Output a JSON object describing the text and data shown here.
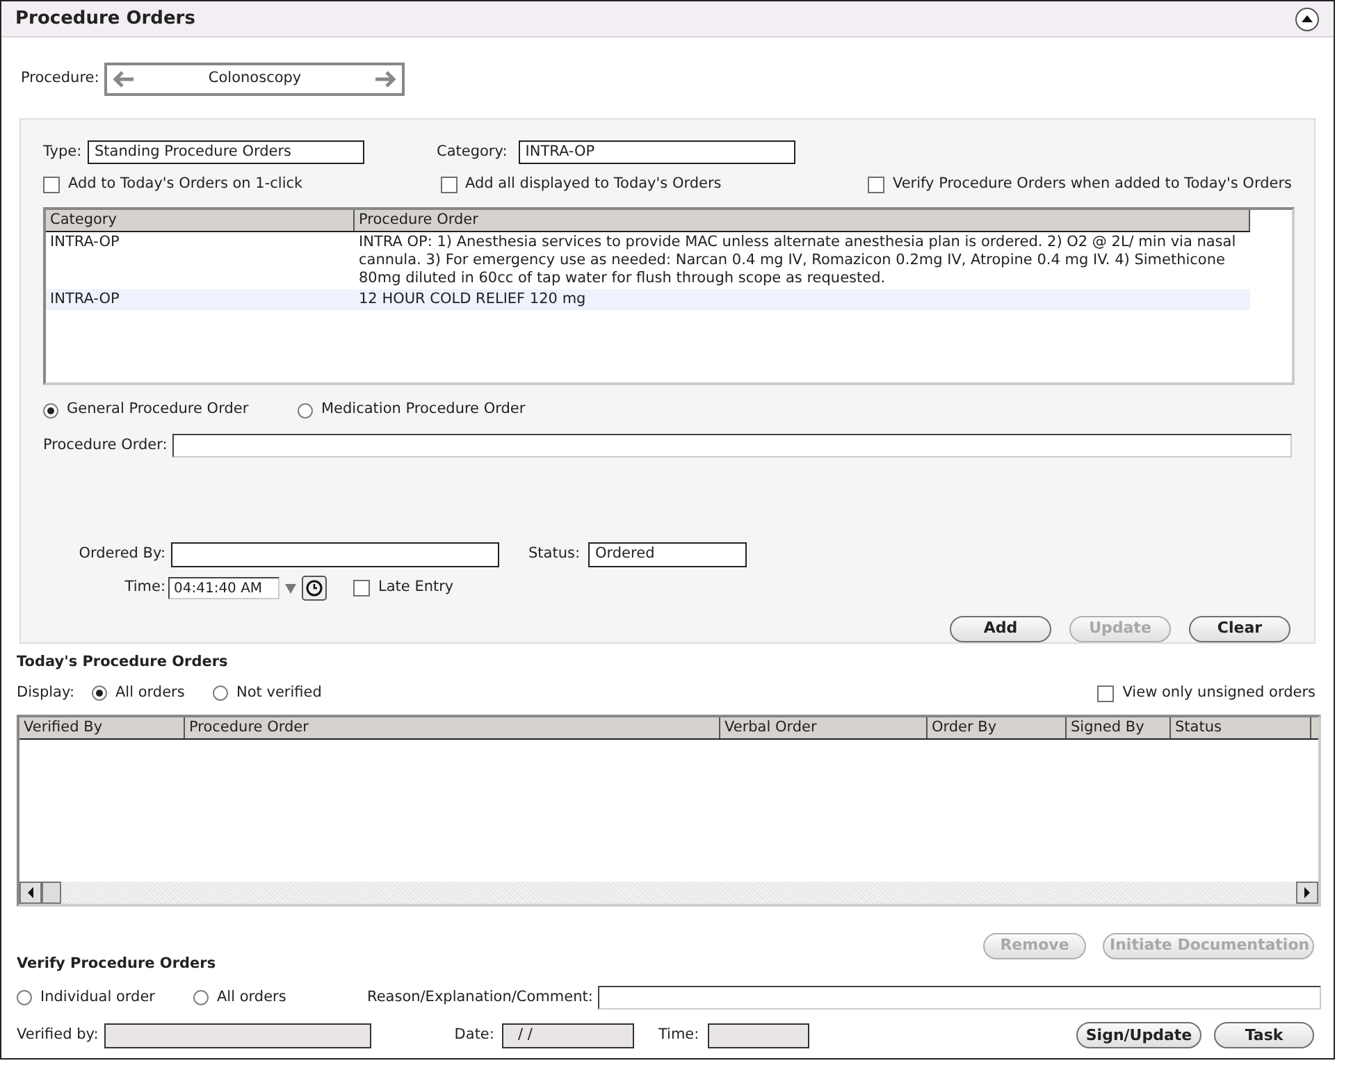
{
  "header": {
    "title": "Procedure Orders"
  },
  "procedure": {
    "label": "Procedure:",
    "value": "Colonoscopy"
  },
  "type_field": {
    "label": "Type:",
    "value": "Standing Procedure Orders"
  },
  "category_field": {
    "label": "Category:",
    "value": "INTRA-OP"
  },
  "options": [
    {
      "label": "Add to Today's Orders on 1-click",
      "checked": false
    },
    {
      "label": "Add all displayed to Today's Orders",
      "checked": false
    },
    {
      "label": "Verify Procedure Orders when added to Today's Orders",
      "checked": false
    }
  ],
  "templates_table": {
    "columns": [
      "Category",
      "Procedure Order"
    ],
    "rows": [
      {
        "cells": [
          "INTRA-OP",
          "INTRA OP: 1) Anesthesia services to provide MAC unless alternate anesthesia plan is ordered. 2) O2 @ 2L/ min via nasal cannula.  3) For emergency use as needed: Narcan 0.4 mg IV, Romazicon 0.2mg IV, Atropine 0.4 mg IV. 4) Simethicone 80mg diluted in 60cc of tap water for flush through scope as requested."
        ],
        "selected": false
      },
      {
        "cells": [
          "INTRA-OP",
          "12 HOUR COLD RELIEF 120 mg"
        ],
        "selected": true
      }
    ]
  },
  "order_kind": [
    {
      "label": "General Procedure Order",
      "selected": true
    },
    {
      "label": "Medication Procedure Order",
      "selected": false
    }
  ],
  "procedure_order": {
    "label": "Procedure Order:"
  },
  "ordered_by": {
    "label": "Ordered By:"
  },
  "status": {
    "label": "Status:",
    "value": "Ordered"
  },
  "time": {
    "label": "Time:",
    "value": "04:41:40 AM"
  },
  "late_entry": {
    "label": "Late Entry",
    "checked": false
  },
  "form_buttons": [
    {
      "label": "Add",
      "disabled": false
    },
    {
      "label": "Update",
      "disabled": true
    },
    {
      "label": "Clear",
      "disabled": false
    }
  ],
  "todays": {
    "title": "Today's Procedure Orders",
    "display_label": "Display:",
    "display_options": [
      {
        "label": "All orders",
        "selected": true
      },
      {
        "label": "Not verified",
        "selected": false
      }
    ],
    "unsigned_only": {
      "label": "View only unsigned orders",
      "checked": false
    },
    "columns": [
      "Verified By",
      "Procedure Order",
      "Verbal Order",
      "Order By",
      "Signed By",
      "Status"
    ],
    "buttons": [
      {
        "label": "Remove",
        "disabled": true
      },
      {
        "label": "Initiate Documentation",
        "disabled": true
      }
    ]
  },
  "verify": {
    "title": "Verify Procedure Orders",
    "scope": [
      {
        "label": "Individual order",
        "selected": false
      },
      {
        "label": "All orders",
        "selected": false
      }
    ],
    "reason_label": "Reason/Explanation/Comment:",
    "verified_by_label": "Verified by:",
    "date_label": "Date:",
    "date_value": "/ /",
    "time_label": "Time:",
    "buttons": [
      {
        "label": "Sign/Update",
        "disabled": false
      },
      {
        "label": "Task",
        "disabled": false
      }
    ]
  }
}
